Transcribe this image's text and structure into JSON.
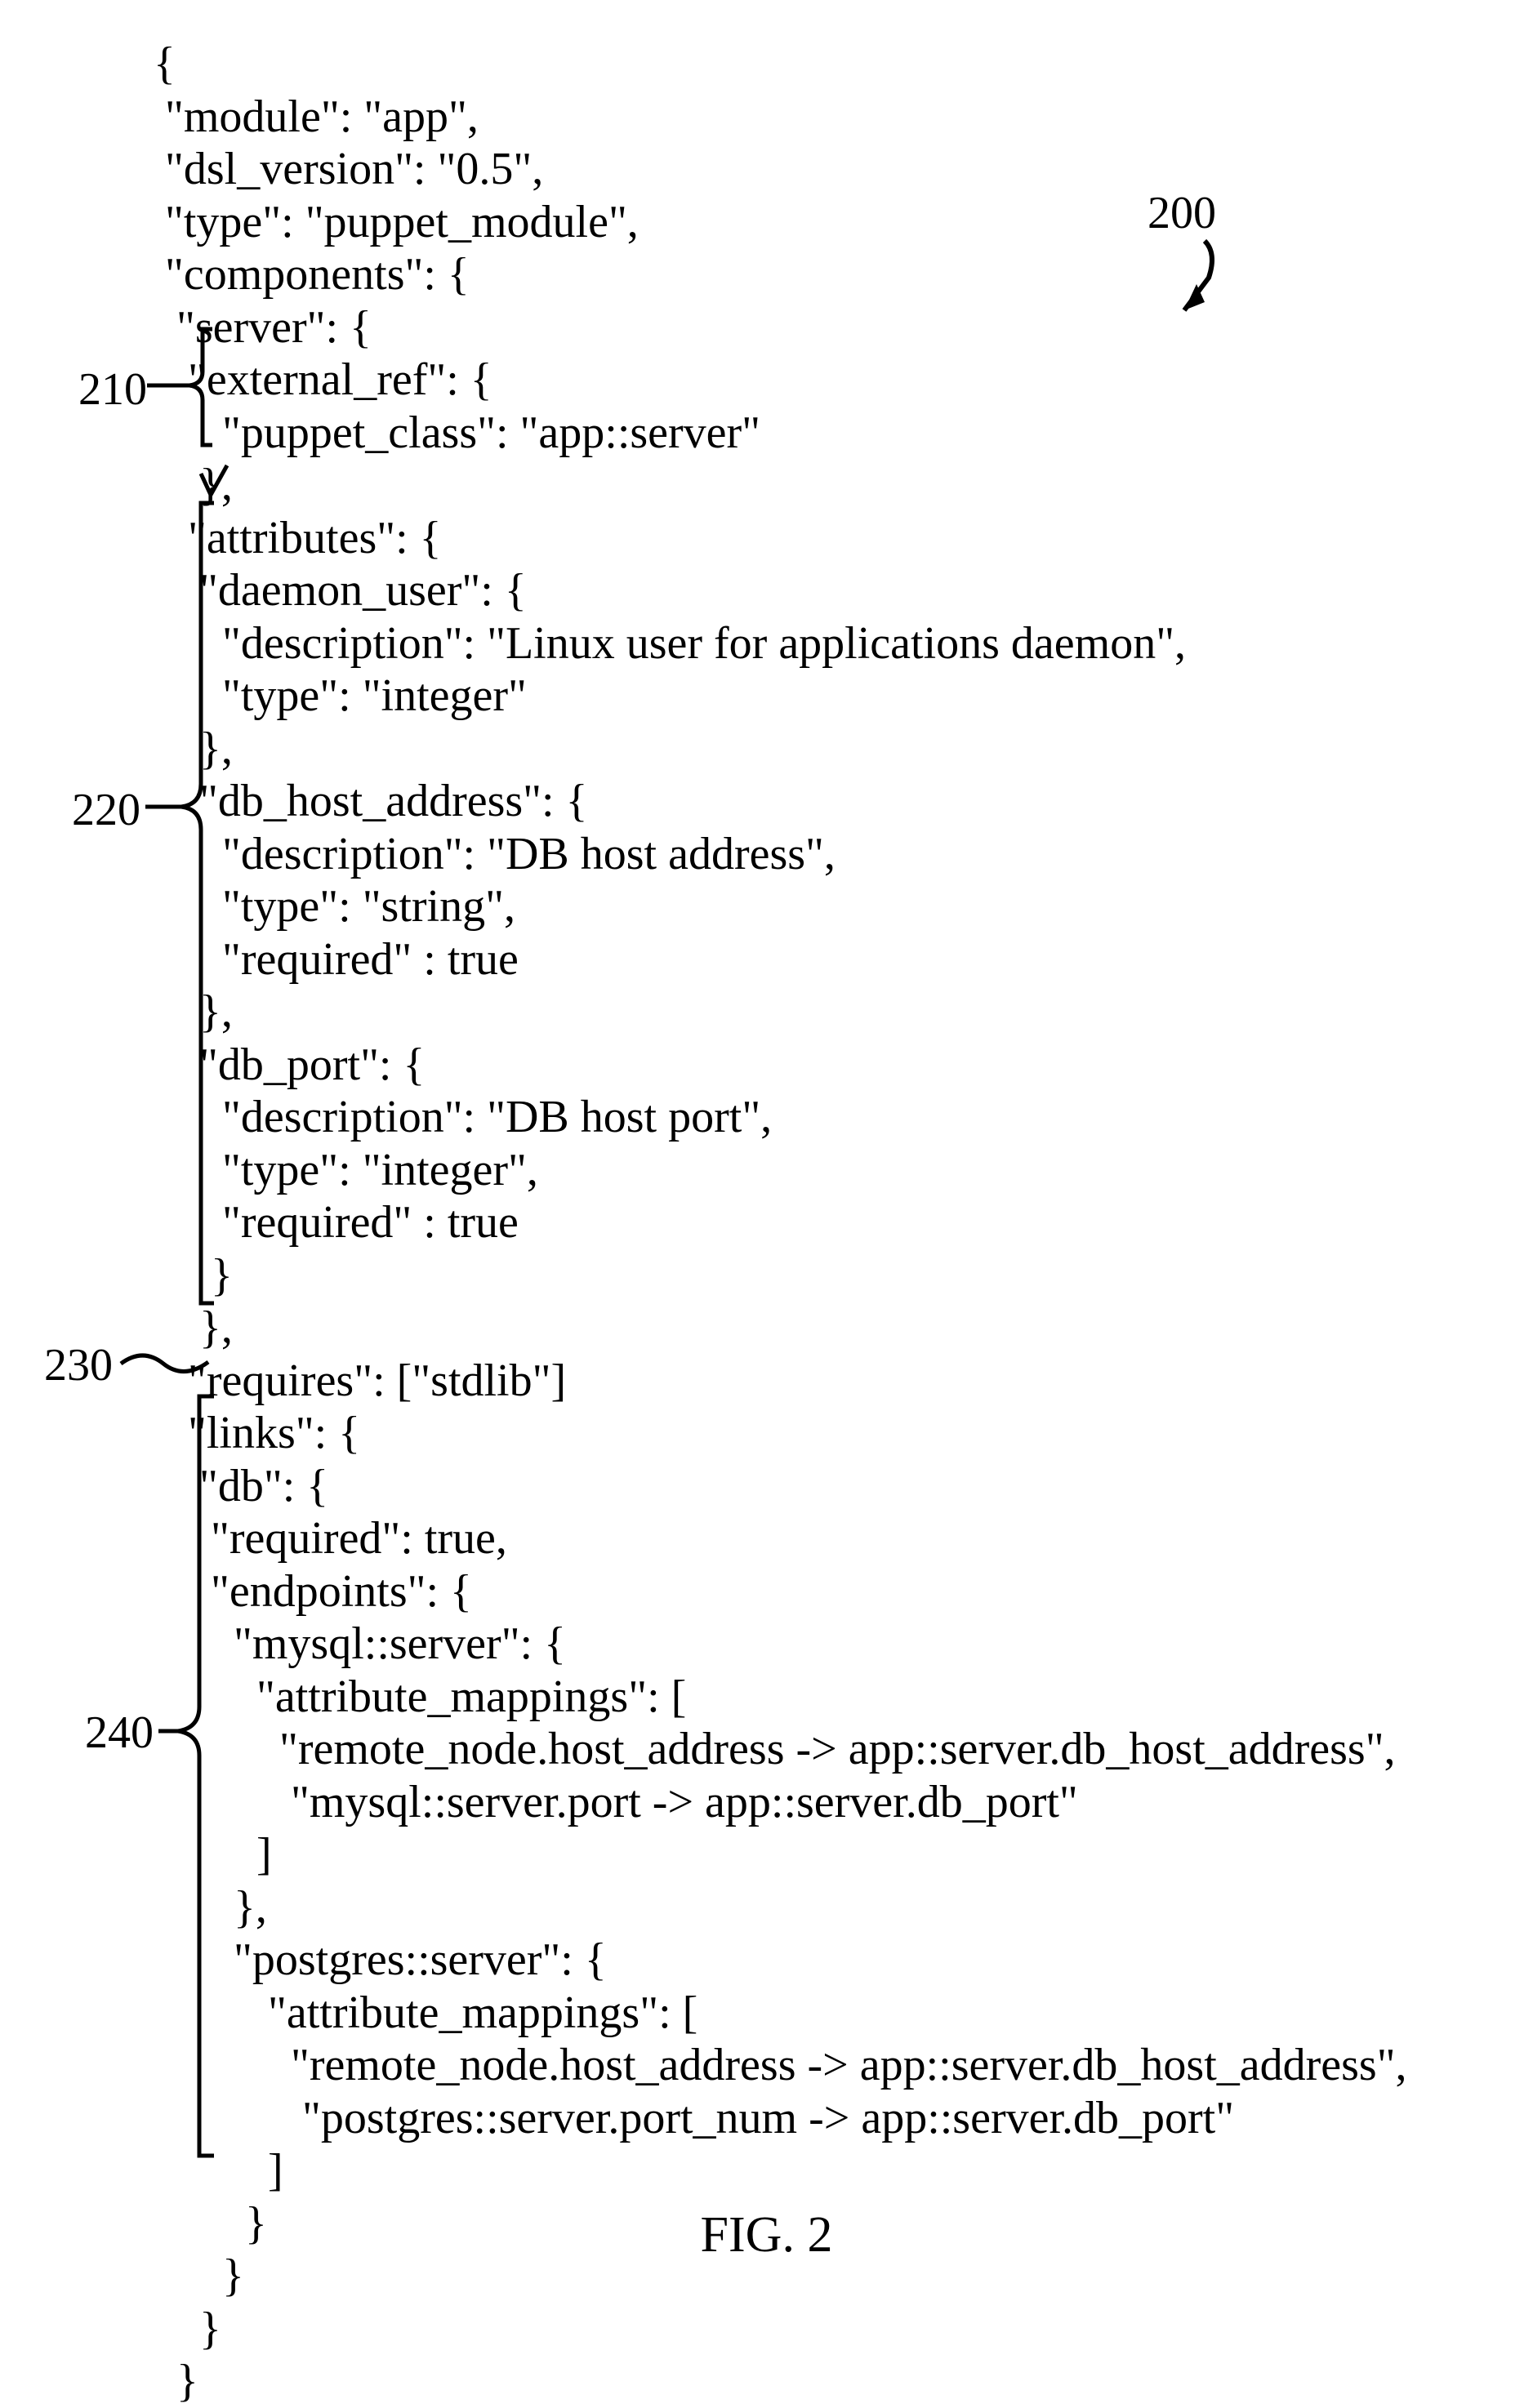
{
  "figure_label": "FIG. 2",
  "annotations": {
    "ref200": "200",
    "ref210": "210",
    "ref220": "220",
    "ref230": "230",
    "ref240": "240"
  },
  "code_lines": [
    "{",
    " \"module\": \"app\",",
    " \"dsl_version\": \"0.5\",",
    " \"type\": \"puppet_module\",",
    " \"components\": {",
    "  \"server\": {",
    "   \"external_ref\": {",
    "      \"puppet_class\": \"app::server\"",
    "    },",
    "   \"attributes\": {",
    "    \"daemon_user\": {",
    "      \"description\": \"Linux user for applications daemon\",",
    "      \"type\": \"integer\"",
    "    },",
    "    \"db_host_address\": {",
    "      \"description\": \"DB host address\",",
    "      \"type\": \"string\",",
    "      \"required\" : true",
    "    },",
    "    \"db_port\": {",
    "      \"description\": \"DB host port\",",
    "      \"type\": \"integer\",",
    "      \"required\" : true",
    "     }",
    "    },",
    "   \"requires\": [\"stdlib\"]",
    "   \"links\": {",
    "    \"db\": {",
    "     \"required\": true,",
    "     \"endpoints\": {",
    "       \"mysql::server\": {",
    "         \"attribute_mappings\": [",
    "           \"remote_node.host_address -> app::server.db_host_address\",",
    "            \"mysql::server.port -> app::server.db_port\"",
    "         ]",
    "       },",
    "       \"postgres::server\": {",
    "          \"attribute_mappings\": [",
    "            \"remote_node.host_address -> app::server.db_host_address\",",
    "             \"postgres::server.port_num -> app::server.db_port\"",
    "          ]",
    "        }",
    "      }",
    "    }",
    "  }"
  ]
}
